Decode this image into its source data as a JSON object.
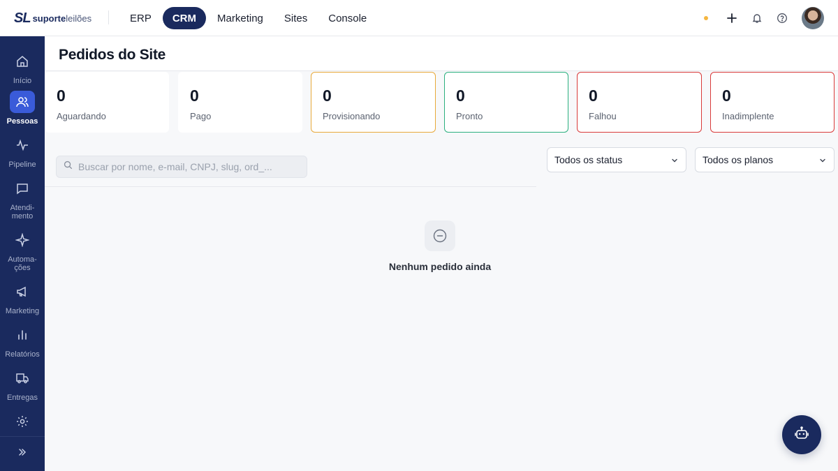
{
  "brand": {
    "mark": "SL",
    "name_bold": "suporte",
    "name_light": "leilões"
  },
  "topnav": {
    "items": [
      {
        "label": "ERP",
        "active": false
      },
      {
        "label": "CRM",
        "active": true
      },
      {
        "label": "Marketing",
        "active": false
      },
      {
        "label": "Sites",
        "active": false
      },
      {
        "label": "Console",
        "active": false
      }
    ]
  },
  "header_actions": {
    "status_dot_color": "#f5b640",
    "icons": [
      "plus-icon",
      "bell-icon",
      "help-icon"
    ]
  },
  "sidebar": {
    "items": [
      {
        "label": "Início",
        "icon": "home-icon",
        "active": false
      },
      {
        "label": "Pessoas",
        "icon": "users-icon",
        "active": true
      },
      {
        "label": "Pipeline",
        "icon": "activity-icon",
        "active": false
      },
      {
        "label": "Atendi-\nmento",
        "icon": "chat-icon",
        "active": false
      },
      {
        "label": "Automa-\nções",
        "icon": "sparkle-icon",
        "active": false
      },
      {
        "label": "Marketing",
        "icon": "megaphone-icon",
        "active": false
      },
      {
        "label": "Relatórios",
        "icon": "bar-chart-icon",
        "active": false
      },
      {
        "label": "Entregas",
        "icon": "truck-icon",
        "active": false
      },
      {
        "label": "",
        "icon": "gear-icon",
        "active": false
      }
    ],
    "expand_icon": "chevrons-right-icon"
  },
  "page": {
    "title": "Pedidos do Site"
  },
  "stats": [
    {
      "value": "0",
      "label": "Aguardando",
      "border": "#ffffff"
    },
    {
      "value": "0",
      "label": "Pago",
      "border": "#ffffff"
    },
    {
      "value": "0",
      "label": "Provisionando",
      "border": "#e8a93a"
    },
    {
      "value": "0",
      "label": "Pronto",
      "border": "#2bb07f"
    },
    {
      "value": "0",
      "label": "Falhou",
      "border": "#d93a3a"
    },
    {
      "value": "0",
      "label": "Inadimplente",
      "border": "#d93a3a"
    }
  ],
  "filters": {
    "search_placeholder": "Buscar por nome, e-mail, CNPJ, slug, ord_...",
    "status_select": "Todos os status",
    "plan_select": "Todos os planos"
  },
  "empty_state": {
    "text": "Nenhum pedido ainda"
  },
  "colors": {
    "sidebar": "#1a2a5e",
    "accent": "#3a5bd9"
  }
}
